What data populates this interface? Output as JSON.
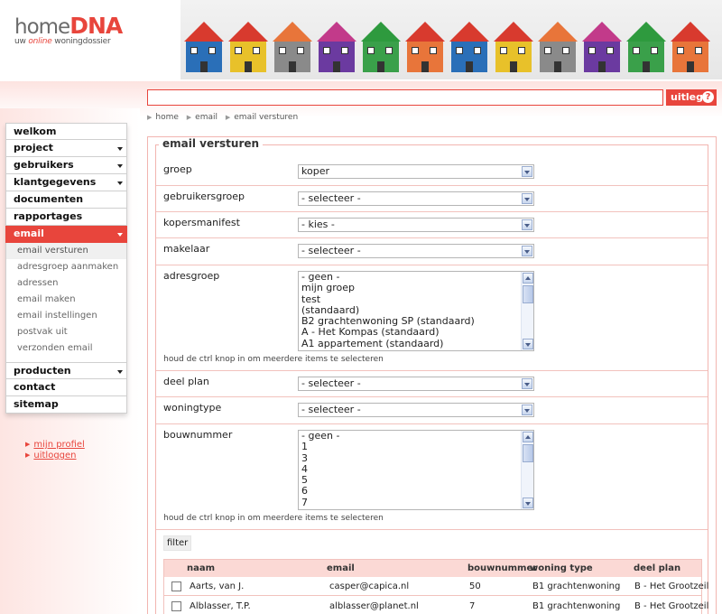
{
  "logo": {
    "home": "home",
    "dna": "DNA",
    "tagline_prefix": "uw",
    "tagline_em": "online",
    "tagline_suffix": "woningdossier"
  },
  "uitleg": {
    "label": "uitleg",
    "icon": "question-icon",
    "glyph": "?"
  },
  "search": {
    "value": ""
  },
  "breadcrumb": [
    "home",
    "email",
    "email versturen"
  ],
  "nav": {
    "items_top": [
      {
        "label": "welkom",
        "caret": false
      },
      {
        "label": "project",
        "caret": true
      },
      {
        "label": "gebruikers",
        "caret": true
      },
      {
        "label": "klantgegevens",
        "caret": true
      },
      {
        "label": "documenten",
        "caret": false
      },
      {
        "label": "rapportages",
        "caret": false
      },
      {
        "label": "email",
        "caret": true,
        "active": true
      }
    ],
    "sub_items": [
      "email versturen",
      "adresgroep aanmaken",
      "adressen",
      "email maken",
      "email instellingen",
      "postvak uit",
      "verzonden email"
    ],
    "items_bottom": [
      {
        "label": "producten",
        "caret": true
      },
      {
        "label": "contact",
        "caret": false
      },
      {
        "label": "sitemap",
        "caret": false
      }
    ]
  },
  "user_links": [
    "mijn profiel",
    "uitloggen"
  ],
  "form": {
    "legend": "email versturen",
    "groep": {
      "label": "groep",
      "value": "koper"
    },
    "gebruikersgroep": {
      "label": "gebruikersgroep",
      "value": "- selecteer -"
    },
    "kopersmanifest": {
      "label": "kopersmanifest",
      "value": "- kies -"
    },
    "makelaar": {
      "label": "makelaar",
      "value": "- selecteer -"
    },
    "adresgroep": {
      "label": "adresgroep",
      "options": [
        "- geen -",
        "mijn groep",
        "test",
        "(standaard)",
        "B2 grachtenwoning SP (standaard)",
        "A - Het Kompas (standaard)",
        "A1 appartement (standaard)"
      ],
      "hint": "houd de ctrl knop in om meerdere items te selecteren"
    },
    "deel_plan": {
      "label": "deel plan",
      "value": "- selecteer -"
    },
    "woningtype": {
      "label": "woningtype",
      "value": "- selecteer -"
    },
    "bouwnummer": {
      "label": "bouwnummer",
      "options": [
        "- geen -",
        "1",
        "3",
        "4",
        "5",
        "6",
        "7"
      ],
      "hint": "houd de ctrl knop in om meerdere items te selecteren"
    },
    "filter_label": "filter"
  },
  "table": {
    "headers": [
      "naam",
      "email",
      "bouwnummer",
      "woning type",
      "deel plan"
    ],
    "rows": [
      {
        "naam": "Aarts, van J.",
        "email": "casper@capica.nl",
        "bouwnummer": "50",
        "woning_type": "B1 grachtenwoning",
        "deel_plan": "B - Het Grootzeil"
      },
      {
        "naam": "Alblasser, T.P.",
        "email": "alblasser@planet.nl",
        "bouwnummer": "7",
        "woning_type": "B1 grachtenwoning",
        "deel_plan": "B - Het Grootzeil"
      }
    ]
  },
  "colors": {
    "accent": "#e8453c",
    "pink_border": "#f2b5b0",
    "table_header": "#fbd9d5"
  }
}
